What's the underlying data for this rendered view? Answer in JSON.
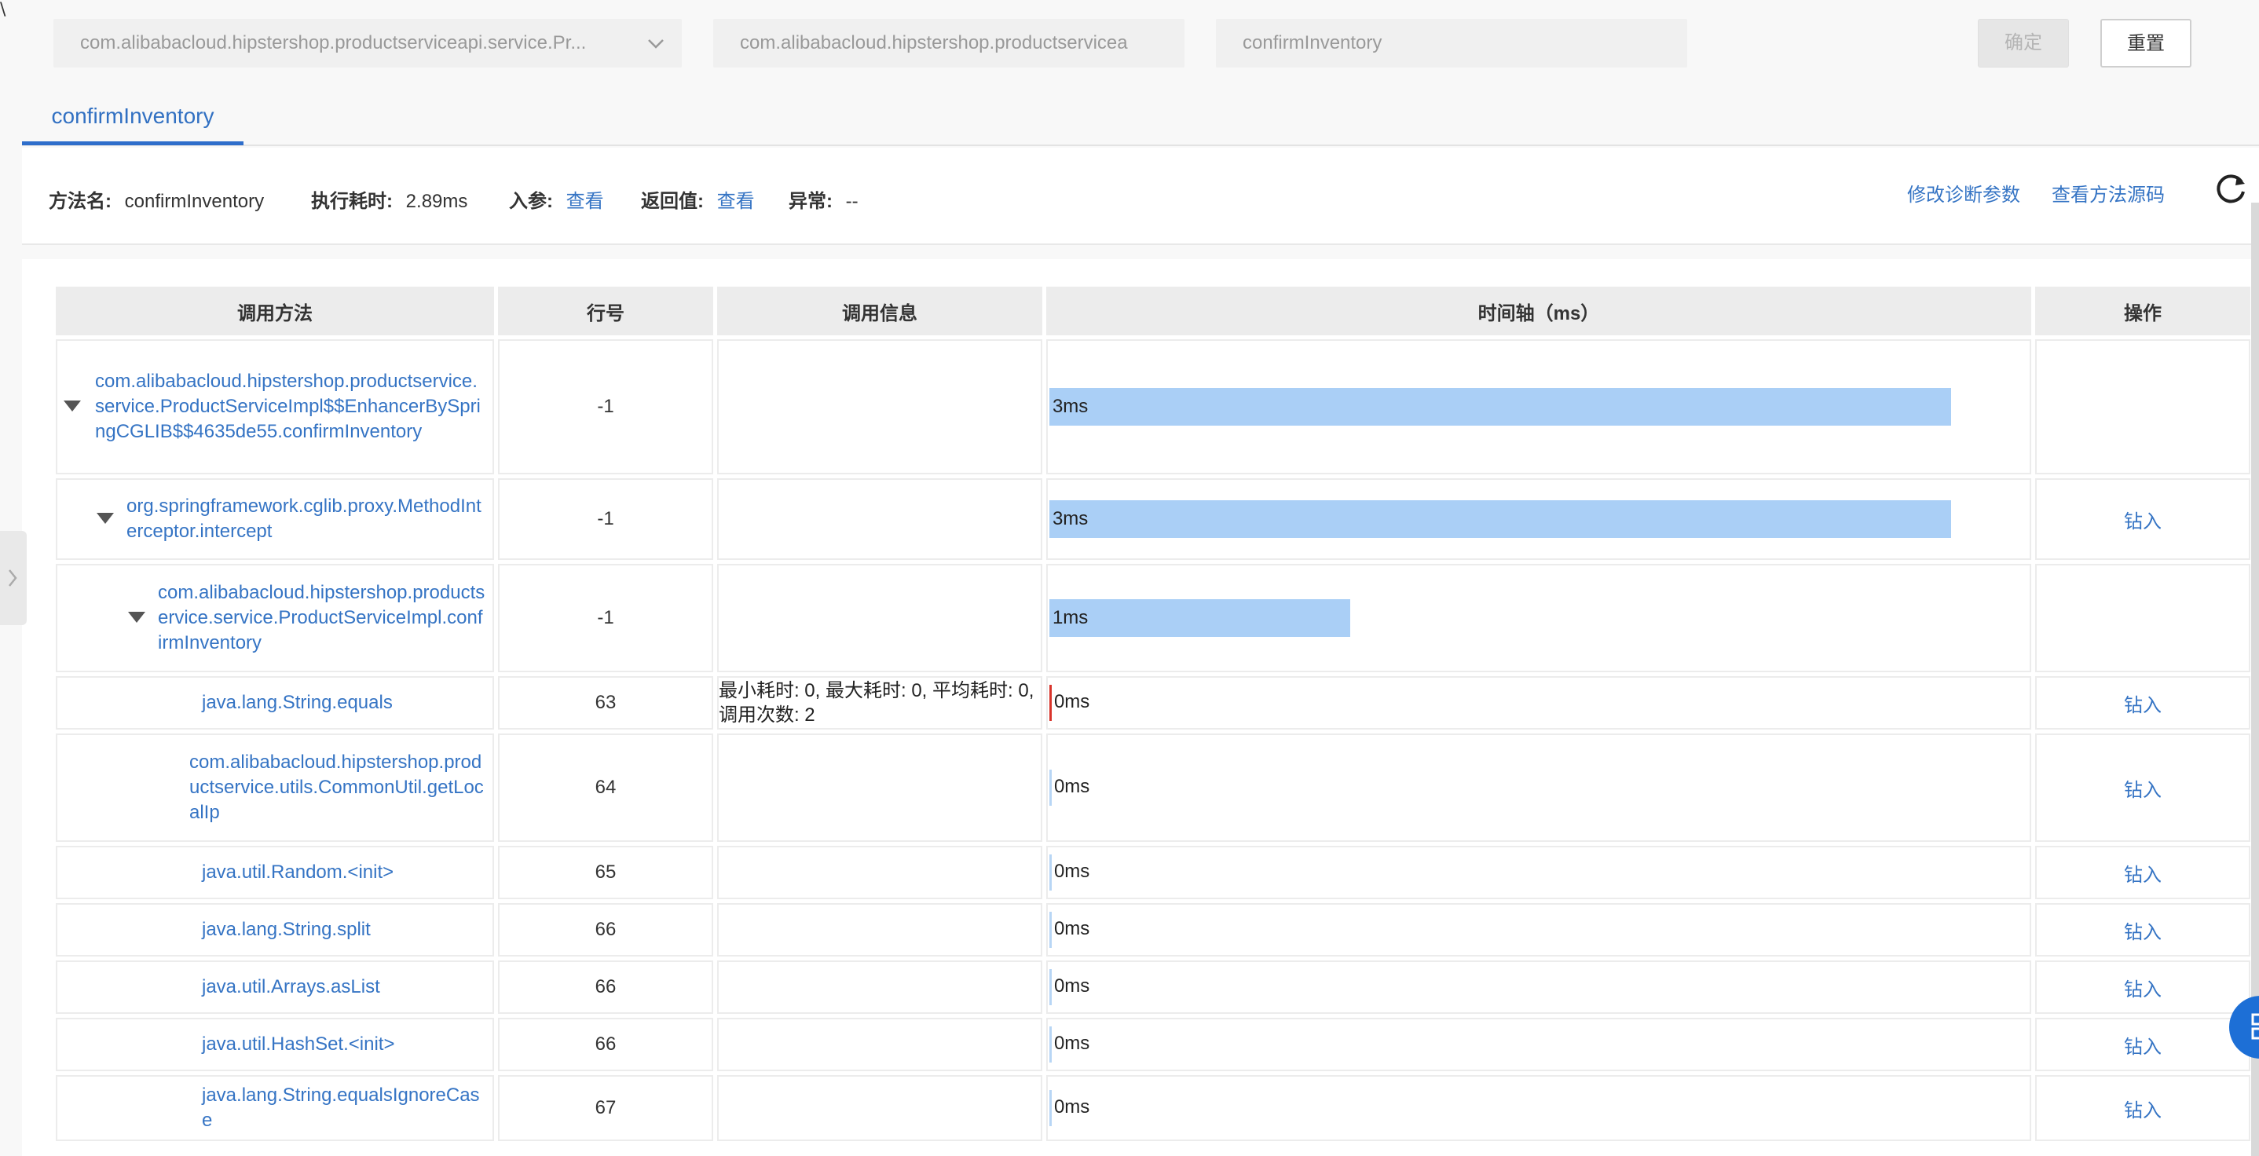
{
  "corner_mark": "\\",
  "filters": {
    "class_select": "com.alibabacloud.hipstershop.productserviceapi.service.Pr...",
    "class_input": "com.alibabacloud.hipstershop.productservicea",
    "method_input": "confirmInventory",
    "confirm_label": "确定",
    "reset_label": "重置"
  },
  "tabs": [
    {
      "label": "confirmInventory",
      "active": true
    }
  ],
  "info": {
    "method_label": "方法名:",
    "method_value": "confirmInventory",
    "time_label": "执行耗时:",
    "time_value": "2.89ms",
    "params_label": "入参:",
    "params_link": "查看",
    "return_label": "返回值:",
    "return_link": "查看",
    "exception_label": "异常:",
    "exception_value": "--",
    "edit_params": "修改诊断参数",
    "view_source": "查看方法源码",
    "refresh_icon": "refresh-icon"
  },
  "table": {
    "headers": [
      "调用方法",
      "行号",
      "调用信息",
      "时间轴（ms）",
      "操作"
    ],
    "rows": [
      {
        "method": "com.alibabacloud.hipstershop.productservice.service.ProductServiceImpl$$EnhancerBySpringCGLIB$$4635de55.confirmInventory",
        "line": "-1",
        "info": "",
        "time": "3ms",
        "time_ms": 3,
        "action": "",
        "expanded": true
      },
      {
        "method": "org.springframework.cglib.proxy.MethodInterceptor.intercept",
        "line": "-1",
        "info": "",
        "time": "3ms",
        "time_ms": 3,
        "action": "钻入",
        "expanded": true
      },
      {
        "method": "com.alibabacloud.hipstershop.productservice.service.ProductServiceImpl.confirmInventory",
        "line": "-1",
        "info": "",
        "time": "1ms",
        "time_ms": 1,
        "action": "",
        "expanded": true
      },
      {
        "method": "java.lang.String.equals",
        "line": "63",
        "info": "最小耗时: 0, 最大耗时: 0, 平均耗时: 0, 调用次数: 2",
        "time": "0ms",
        "time_ms": 0,
        "action": "钻入",
        "highlight": "red"
      },
      {
        "method": "com.alibabacloud.hipstershop.productservice.utils.CommonUtil.getLocalIp",
        "line": "64",
        "info": "",
        "time": "0ms",
        "time_ms": 0,
        "action": "钻入"
      },
      {
        "method": "java.util.Random.<init>",
        "line": "65",
        "info": "",
        "time": "0ms",
        "time_ms": 0,
        "action": "钻入"
      },
      {
        "method": "java.lang.String.split",
        "line": "66",
        "info": "",
        "time": "0ms",
        "time_ms": 0,
        "action": "钻入"
      },
      {
        "method": "java.util.Arrays.asList",
        "line": "66",
        "info": "",
        "time": "0ms",
        "time_ms": 0,
        "action": "钻入"
      },
      {
        "method": "java.util.HashSet.<init>",
        "line": "66",
        "info": "",
        "time": "0ms",
        "time_ms": 0,
        "action": "钻入"
      },
      {
        "method": "java.lang.String.equalsIgnoreCase",
        "line": "67",
        "info": "",
        "time": "0ms",
        "time_ms": 0,
        "action": "钻入"
      }
    ]
  },
  "colors": {
    "accent": "#3574c4",
    "bar": "#aacff6",
    "mark_red": "#d9342b"
  }
}
